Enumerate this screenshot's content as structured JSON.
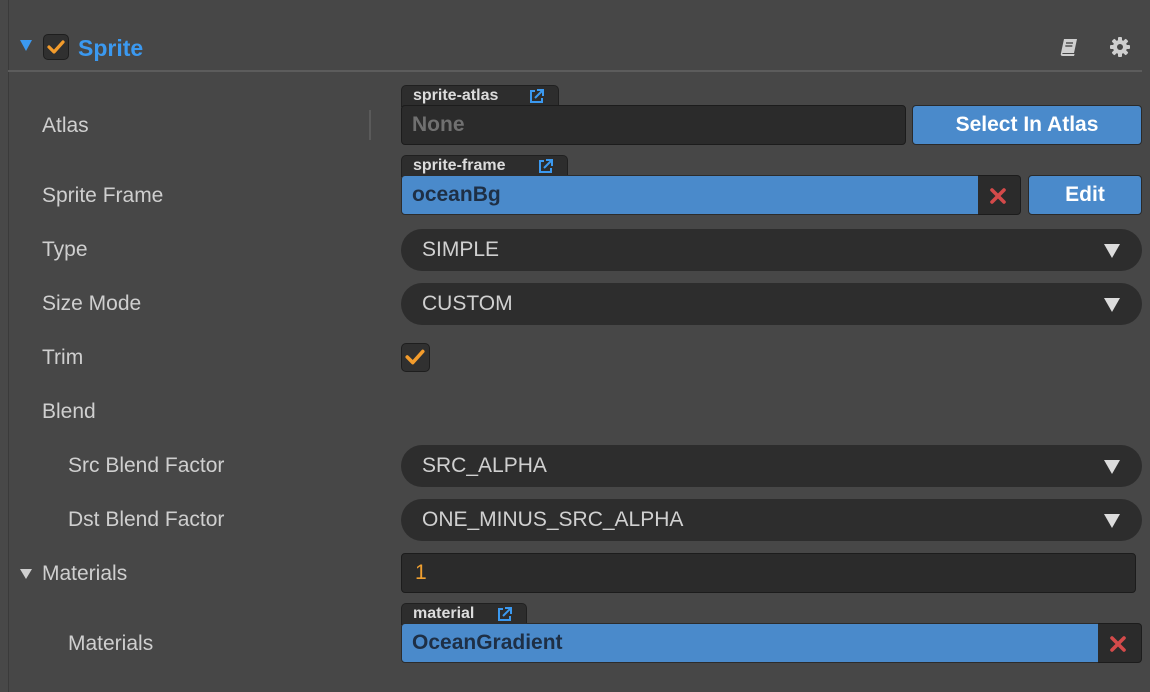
{
  "component": {
    "title": "Sprite",
    "enabled": true,
    "icons": {
      "help": "book-icon",
      "settings": "gear-icon"
    }
  },
  "atlas": {
    "label": "Atlas",
    "tag": "sprite-atlas",
    "value": "None",
    "button": "Select In Atlas"
  },
  "sprite_frame": {
    "label": "Sprite Frame",
    "tag": "sprite-frame",
    "value": "oceanBg",
    "button": "Edit"
  },
  "type": {
    "label": "Type",
    "value": "SIMPLE"
  },
  "size_mode": {
    "label": "Size Mode",
    "value": "CUSTOM"
  },
  "trim": {
    "label": "Trim",
    "checked": true
  },
  "blend": {
    "label": "Blend",
    "src": {
      "label": "Src Blend Factor",
      "value": "SRC_ALPHA"
    },
    "dst": {
      "label": "Dst Blend Factor",
      "value": "ONE_MINUS_SRC_ALPHA"
    }
  },
  "materials": {
    "label": "Materials",
    "count": "1",
    "item_label": "Materials",
    "tag": "material",
    "value": "OceanGradient"
  },
  "colors": {
    "accent": "#3b99f0",
    "check": "#f39c2c",
    "asset_field": "#4a8acb",
    "remove": "#d44a4a",
    "number": "#f0a030"
  }
}
